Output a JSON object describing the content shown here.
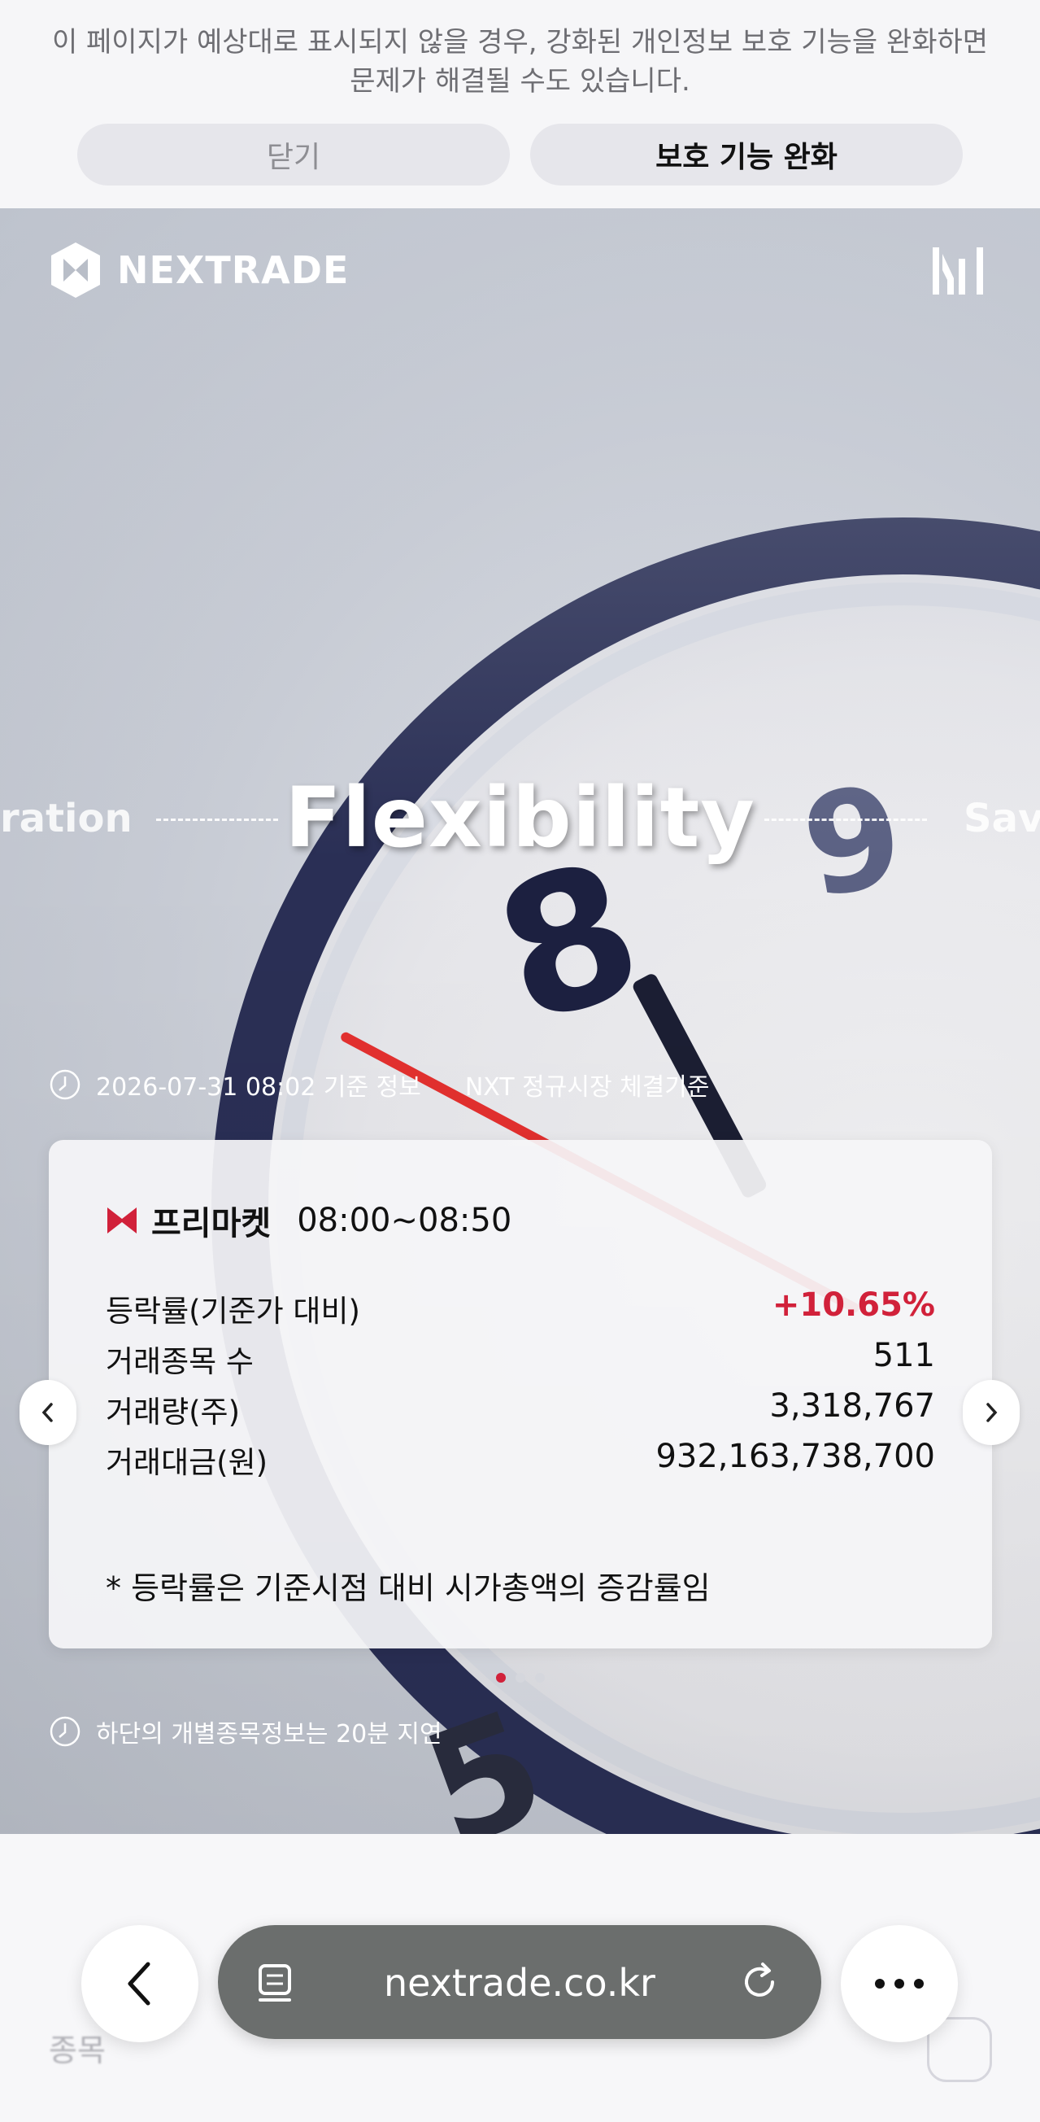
{
  "privacy_banner": {
    "message": "이 페이지가 예상대로 표시되지 않을 경우, 강화된 개인정보 보호 기능을 완화하면 문제가 해결될 수도 있습니다.",
    "close_label": "닫기",
    "relax_label": "보호 기능 완화"
  },
  "header": {
    "logo_text": "NEXTRADE",
    "menu_icon": "menu-icon"
  },
  "hero": {
    "slogan_left": "ration",
    "slogan_main": "Flexibility",
    "slogan_right": "Sav",
    "as_of": "2026-07-31 08:02 기준 정보",
    "market_basis": "NXT 정규시장 체결기준",
    "delay_note": "하단의 개별종목정보는 20분 지연"
  },
  "card": {
    "session_name": "프리마켓",
    "session_time": "08:00~08:50",
    "stats": [
      {
        "label": "등락률(기준가 대비)",
        "value": "+10.65%"
      },
      {
        "label": "거래종목 수",
        "value": "511"
      },
      {
        "label": "거래량(주)",
        "value": "3,318,767"
      },
      {
        "label": "거래대금(원)",
        "value": "932,163,738,700"
      }
    ],
    "note": "* 등락률은 기준시점 대비 시가총액의 증감률임",
    "page_count": 3,
    "active_page": 1
  },
  "below": {
    "section_label": "종목"
  },
  "browser": {
    "url": "nextrade.co.kr"
  },
  "colors": {
    "accent_red": "#d1213a",
    "url_bar": "#6b6e6d"
  }
}
